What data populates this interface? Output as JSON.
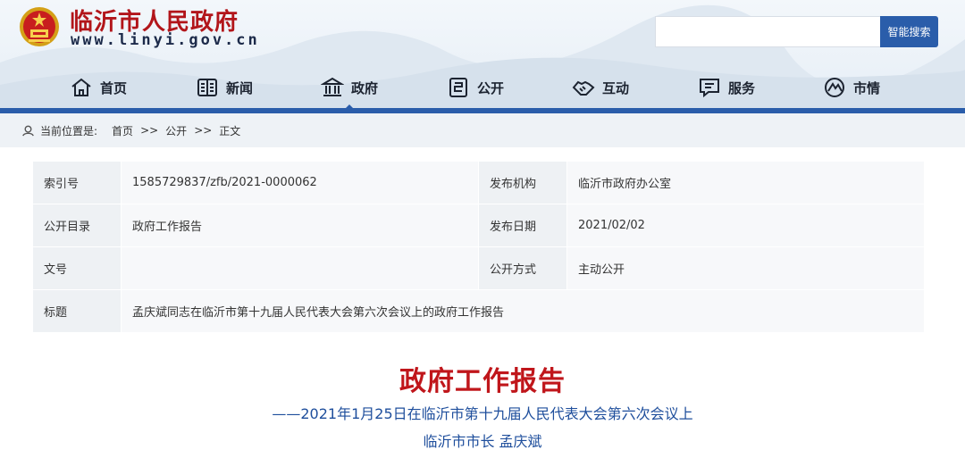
{
  "site": {
    "title": "临沂市人民政府",
    "url": "www.linyi.gov.cn"
  },
  "search": {
    "placeholder": "",
    "button_label": "智能搜索"
  },
  "nav": {
    "items": [
      {
        "label": "首页",
        "icon": "home-icon"
      },
      {
        "label": "新闻",
        "icon": "news-icon"
      },
      {
        "label": "政府",
        "icon": "government-building-icon"
      },
      {
        "label": "公开",
        "icon": "disclosure-icon"
      },
      {
        "label": "互动",
        "icon": "handshake-icon"
      },
      {
        "label": "服务",
        "icon": "service-icon"
      },
      {
        "label": "市情",
        "icon": "city-info-icon"
      }
    ],
    "active": "政府"
  },
  "breadcrumb": {
    "prefix": "当前位置是:",
    "items": [
      "首页",
      "公开",
      "正文"
    ],
    "separator": ">>"
  },
  "info": {
    "index_label": "索引号",
    "index_value": "1585729837/zfb/2021-0000062",
    "publisher_label": "发布机构",
    "publisher_value": "临沂市政府办公室",
    "catalog_label": "公开目录",
    "catalog_value": "政府工作报告",
    "date_label": "发布日期",
    "date_value": "2021/02/02",
    "docno_label": "文号",
    "docno_value": "",
    "mode_label": "公开方式",
    "mode_value": "主动公开",
    "subject_label": "标题",
    "subject_value": "孟庆斌同志在临沂市第十九届人民代表大会第六次会议上的政府工作报告"
  },
  "article": {
    "title": "政府工作报告",
    "subtitle": "——2021年1月25日在临沂市第十九届人民代表大会第六次会议上",
    "author": "临沂市市长 孟庆斌"
  },
  "colors": {
    "brand_red": "#b2151a",
    "nav_blue": "#2a5daa",
    "link_blue": "#1e4e9c"
  }
}
